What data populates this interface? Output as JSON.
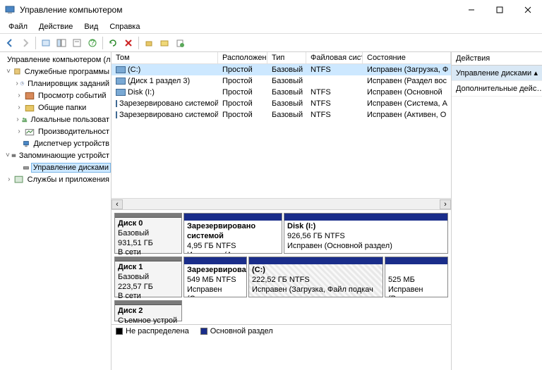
{
  "window": {
    "title": "Управление компьютером"
  },
  "menu": {
    "file": "Файл",
    "action": "Действие",
    "view": "Вид",
    "help": "Справка"
  },
  "tree": {
    "root": "Управление компьютером (лс",
    "systools": "Служебные программы",
    "systools_children": {
      "scheduler": "Планировщик заданий",
      "eventvwr": "Просмотр событий",
      "shared": "Общие папки",
      "users": "Локальные пользоват",
      "perf": "Производительност",
      "devmgr": "Диспетчер устройств"
    },
    "storage": "Запоминающие устройст",
    "diskmgmt": "Управление дисками",
    "services": "Службы и приложения"
  },
  "columns": {
    "volume": "Том",
    "layout": "Расположение",
    "type": "Тип",
    "fs": "Файловая система",
    "status": "Состояние"
  },
  "volumes": [
    {
      "name": "(C:)",
      "layout": "Простой",
      "type": "Базовый",
      "fs": "NTFS",
      "status": "Исправен (Загрузка, Ф",
      "sel": true
    },
    {
      "name": "(Диск 1 раздел 3)",
      "layout": "Простой",
      "type": "Базовый",
      "fs": "",
      "status": "Исправен (Раздел вос"
    },
    {
      "name": "Disk (I:)",
      "layout": "Простой",
      "type": "Базовый",
      "fs": "NTFS",
      "status": "Исправен (Основной"
    },
    {
      "name": "Зарезервировано системой",
      "layout": "Простой",
      "type": "Базовый",
      "fs": "NTFS",
      "status": "Исправен (Система, А"
    },
    {
      "name": "Зарезервировано системой (D:)",
      "layout": "Простой",
      "type": "Базовый",
      "fs": "NTFS",
      "status": "Исправен (Активен, О"
    }
  ],
  "disks": {
    "d0": {
      "title": "Диск 0",
      "type": "Базовый",
      "size": "931,51 ГБ",
      "status": "В сети",
      "p0": {
        "name": "Зарезервировано системой",
        "size": "4,95 ГБ NTFS",
        "status": "Исправен (Активен, Основн"
      },
      "p1": {
        "name": "Disk  (I:)",
        "size": "926,56 ГБ NTFS",
        "status": "Исправен (Основной раздел)"
      }
    },
    "d1": {
      "title": "Диск 1",
      "type": "Базовый",
      "size": "223,57 ГБ",
      "status": "В сети",
      "p0": {
        "name": "Зарезервирова",
        "size": "549 МБ NTFS",
        "status": "Исправен (Сист"
      },
      "p1": {
        "name": "(C:)",
        "size": "222,52 ГБ NTFS",
        "status": "Исправен (Загрузка, Файл подкач"
      },
      "p2": {
        "name": "",
        "size": "525 МБ",
        "status": "Исправен (Разд"
      }
    },
    "d2": {
      "title": "Диск 2",
      "type": "Съемное устрой"
    }
  },
  "legend": {
    "unalloc": "Не распределена",
    "primary": "Основной раздел"
  },
  "actions": {
    "head": "Действия",
    "diskmgmt": "Управление дисками",
    "more": "Дополнительные дейс…"
  }
}
